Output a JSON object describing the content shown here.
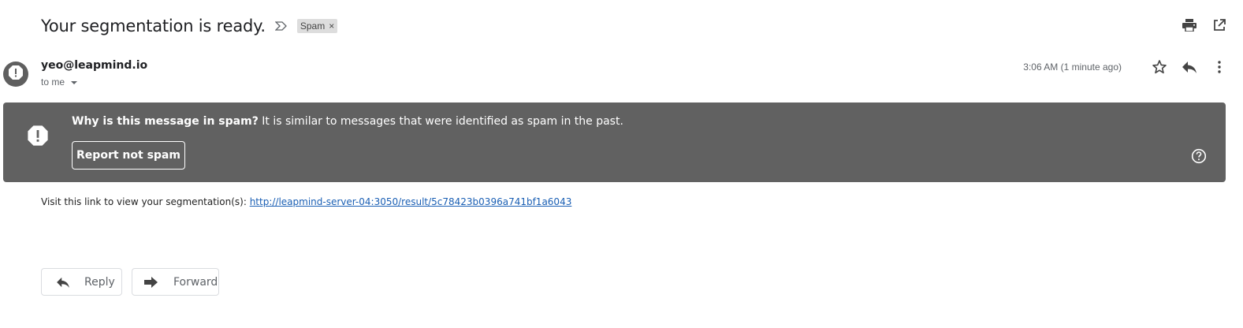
{
  "subject": "Your segmentation is ready.",
  "label_chip": {
    "label": "Spam",
    "remove_glyph": "×"
  },
  "top_actions": [
    {
      "icon": "print-icon"
    },
    {
      "icon": "open-in-new-window-icon"
    }
  ],
  "sender": {
    "email": "yeo@leapmind.io",
    "to": "to me",
    "timestamp": "3:06 AM (1 minute ago)",
    "avatar_icon": "spam-warning-icon"
  },
  "message_actions": [
    {
      "icon": "star-icon"
    },
    {
      "icon": "reply-icon"
    },
    {
      "icon": "more-vert-icon"
    }
  ],
  "spam_banner": {
    "title": "Why is this message in spam?",
    "explanation": " It is similar to messages that were identified as spam in the past.",
    "button": "Report not spam",
    "help_icon": "help-circle-icon",
    "background": "#616161"
  },
  "body": {
    "text": "Visit this link to view your segmentation(s): ",
    "link": "http://leapmind-server-04:3050/result/5c78423b0396a741bf1a6043",
    "link_color": "#1a5fb4"
  },
  "footer_buttons": {
    "reply": "Reply",
    "forward": "Forward"
  }
}
